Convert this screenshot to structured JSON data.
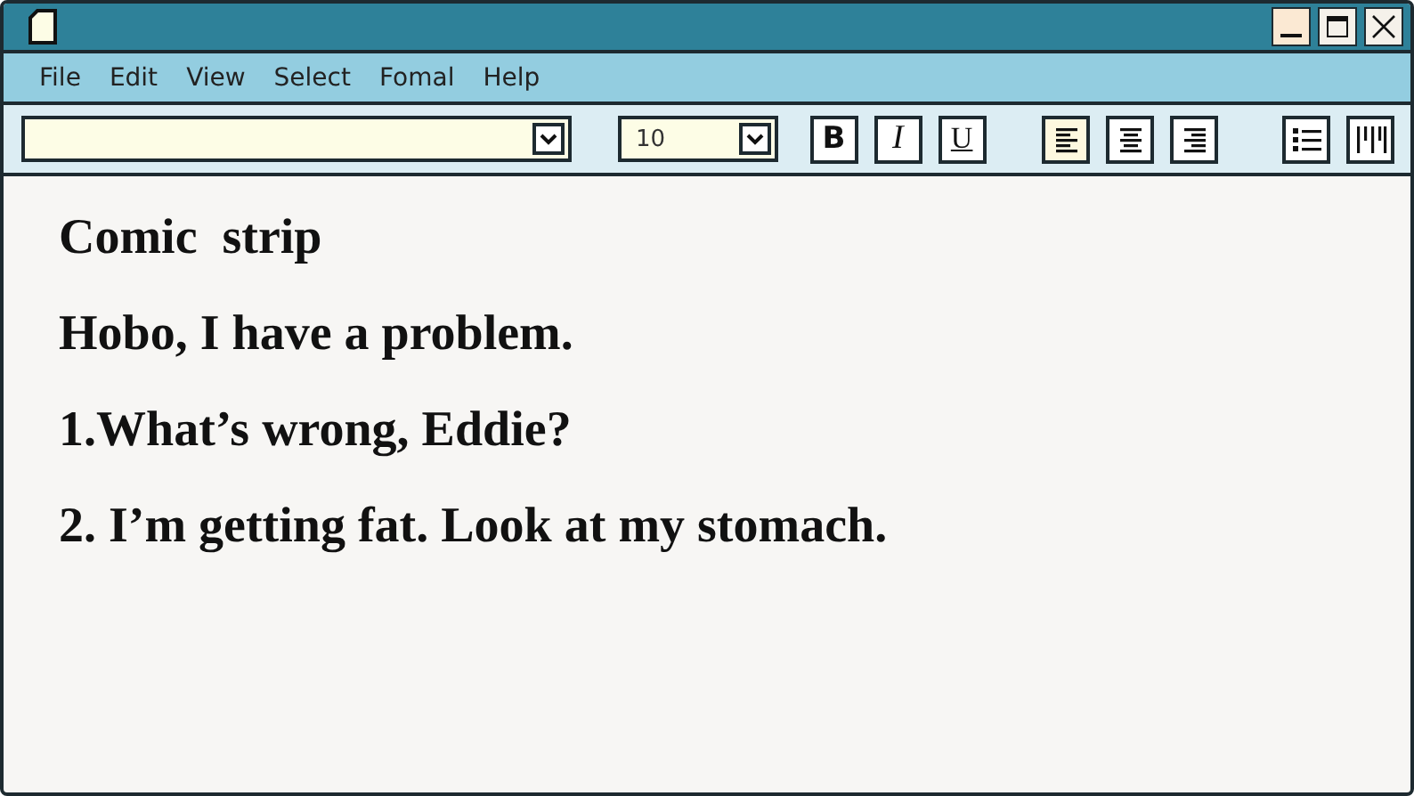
{
  "menu": [
    "File",
    "Edit",
    "View",
    "Select",
    "Fomal",
    "Help"
  ],
  "toolbar": {
    "size_field": {
      "value": "10"
    },
    "format_buttons": [
      {
        "kind": "bold",
        "label": "B"
      },
      {
        "kind": "italic",
        "label": "I"
      },
      {
        "kind": "underline",
        "label": "U"
      }
    ],
    "align_buttons": [
      {
        "kind": "left",
        "selected": true
      },
      {
        "kind": "center",
        "selected": false
      },
      {
        "kind": "right",
        "selected": false
      }
    ],
    "list_buttons": [
      {
        "kind": "bullets"
      },
      {
        "kind": "columns"
      }
    ]
  },
  "document": {
    "lines": [
      "Comic  strip",
      "Hobo, I have a problem.",
      "1.What’s wrong, Eddie?",
      "2. I’m getting fat. Look at my stomach."
    ]
  }
}
